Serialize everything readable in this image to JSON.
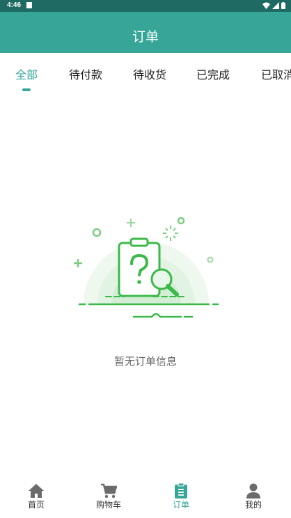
{
  "status_bar": {
    "time": "4:46",
    "icons": [
      "sim-icon",
      "wifi-icon",
      "signal-icon",
      "battery-icon"
    ]
  },
  "app_bar": {
    "title": "订单"
  },
  "tabs": [
    {
      "label": "全部",
      "active": true
    },
    {
      "label": "待付款",
      "active": false
    },
    {
      "label": "待收货",
      "active": false
    },
    {
      "label": "已完成",
      "active": false
    },
    {
      "label": "已取消",
      "active": false
    }
  ],
  "empty_state": {
    "message": "暂无订单信息",
    "icon": "empty-clipboard-question-icon"
  },
  "bottom_nav": [
    {
      "label": "首页",
      "icon": "home-icon",
      "active": false
    },
    {
      "label": "购物车",
      "icon": "cart-icon",
      "active": false
    },
    {
      "label": "订单",
      "icon": "clipboard-icon",
      "active": true
    },
    {
      "label": "我的",
      "icon": "person-icon",
      "active": false
    }
  ],
  "colors": {
    "primary": "#37a699",
    "status_bar": "#1f6b63",
    "illustration_green": "#3cb94a",
    "text_gray": "#666666"
  }
}
